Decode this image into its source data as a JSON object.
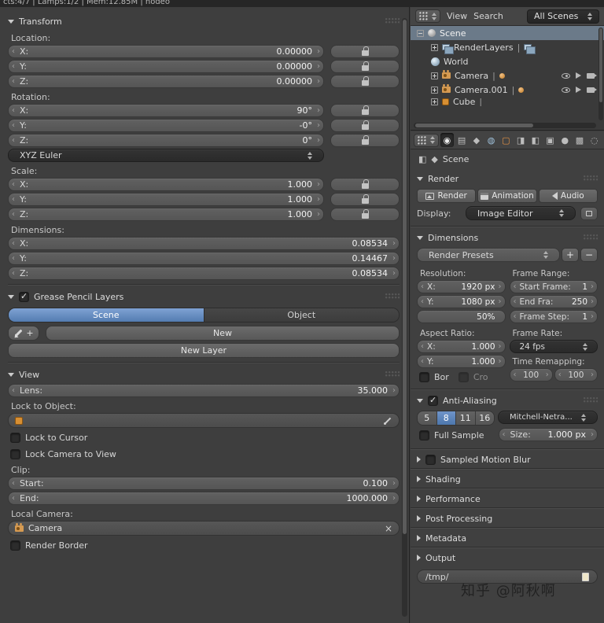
{
  "topbar": {
    "info": "cts:4/7 | Lamps:1/2 | Mem:12.85M | nodeo"
  },
  "icons": {
    "plus": "+",
    "minus": "−",
    "close": "×",
    "pipe": "|",
    "tab_render": "◉",
    "tab_render_layers": "▤",
    "tab_scene": "◆",
    "tab_world": "◍",
    "tab_object": "▢",
    "tab_constraints": "◨",
    "tab_modifiers": "◧",
    "tab_data": "▣",
    "tab_material": "●",
    "tab_texture": "▩",
    "tab_physics": "◌",
    "crumb_tool": "◧",
    "crumb_scene": "◆"
  },
  "transform": {
    "title": "Transform",
    "location": {
      "label": "Location:",
      "fields": [
        {
          "l": "X:",
          "v": "0.00000"
        },
        {
          "l": "Y:",
          "v": "0.00000"
        },
        {
          "l": "Z:",
          "v": "0.00000"
        }
      ]
    },
    "rotation": {
      "label": "Rotation:",
      "mode": "XYZ Euler",
      "fields": [
        {
          "l": "X:",
          "v": "90°"
        },
        {
          "l": "Y:",
          "v": "-0°"
        },
        {
          "l": "Z:",
          "v": "0°"
        }
      ]
    },
    "scale": {
      "label": "Scale:",
      "fields": [
        {
          "l": "X:",
          "v": "1.000"
        },
        {
          "l": "Y:",
          "v": "1.000"
        },
        {
          "l": "Z:",
          "v": "1.000"
        }
      ]
    },
    "dimensions": {
      "label": "Dimensions:",
      "fields": [
        {
          "l": "X:",
          "v": "0.08534"
        },
        {
          "l": "Y:",
          "v": "0.14467"
        },
        {
          "l": "Z:",
          "v": "0.08534"
        }
      ]
    }
  },
  "grease_pencil": {
    "title": "Grease Pencil Layers",
    "tab_scene": "Scene",
    "tab_object": "Object",
    "new_button": "New",
    "new_layer_button": "New Layer"
  },
  "view": {
    "title": "View",
    "lens_label": "Lens:",
    "lens_value": "35.000",
    "lock_to_object_label": "Lock to Object:",
    "lock_to_cursor_label": "Lock to Cursor",
    "lock_camera_label": "Lock Camera to View",
    "clip_label": "Clip:",
    "clip_start_label": "Start:",
    "clip_start_value": "0.100",
    "clip_end_label": "End:",
    "clip_end_value": "1000.000",
    "local_camera_label": "Local Camera:",
    "camera_value": "Camera",
    "render_border_label": "Render Border"
  },
  "outliner": {
    "menu_view": "View",
    "menu_search": "Search",
    "mode": "All Scenes",
    "rows": [
      {
        "label": "Scene"
      },
      {
        "label": "RenderLayers"
      },
      {
        "label": "World"
      },
      {
        "label": "Camera"
      },
      {
        "label": "Camera.001"
      },
      {
        "label": "Cube"
      }
    ]
  },
  "properties": {
    "breadcrumb": "Scene",
    "render": {
      "title": "Render",
      "render_button": "Render",
      "animation_button": "Animation",
      "audio_button": "Audio",
      "display_label": "Display:",
      "display_value": "Image Editor"
    },
    "dimensions": {
      "title": "Dimensions",
      "presets": "Render Presets",
      "resolution_label": "Resolution:",
      "res_x_label": "X:",
      "res_x_value": "1920 px",
      "res_y_label": "Y:",
      "res_y_value": "1080 px",
      "percent_value": "50%",
      "frame_range_label": "Frame Range:",
      "start_label": "Start Frame:",
      "start_value": "1",
      "end_label": "End Fra:",
      "end_value": "250",
      "step_label": "Frame Step:",
      "step_value": "1",
      "aspect_label": "Aspect Ratio:",
      "aspect_x_label": "X:",
      "aspect_x_value": "1.000",
      "aspect_y_label": "Y:",
      "aspect_y_value": "1.000",
      "frame_rate_label": "Frame Rate:",
      "fps_value": "24 fps",
      "time_remap_label": "Time Remapping:",
      "remap_a": "100",
      "remap_b": "100",
      "border_label": "Bor",
      "crop_label": "Cro"
    },
    "antialiasing": {
      "title": "Anti-Aliasing",
      "samples": [
        "5",
        "8",
        "11",
        "16"
      ],
      "filter_value": "Mitchell-Netra...",
      "full_sample_label": "Full Sample",
      "size_label": "Size:",
      "size_value": "1.000 px"
    },
    "motion_blur_label": "Sampled Motion Blur",
    "shading_label": "Shading",
    "performance_label": "Performance",
    "post_processing_label": "Post Processing",
    "metadata_label": "Metadata",
    "output": {
      "title": "Output",
      "path": "/tmp/"
    }
  },
  "watermark": "知乎 @阿秋啊"
}
